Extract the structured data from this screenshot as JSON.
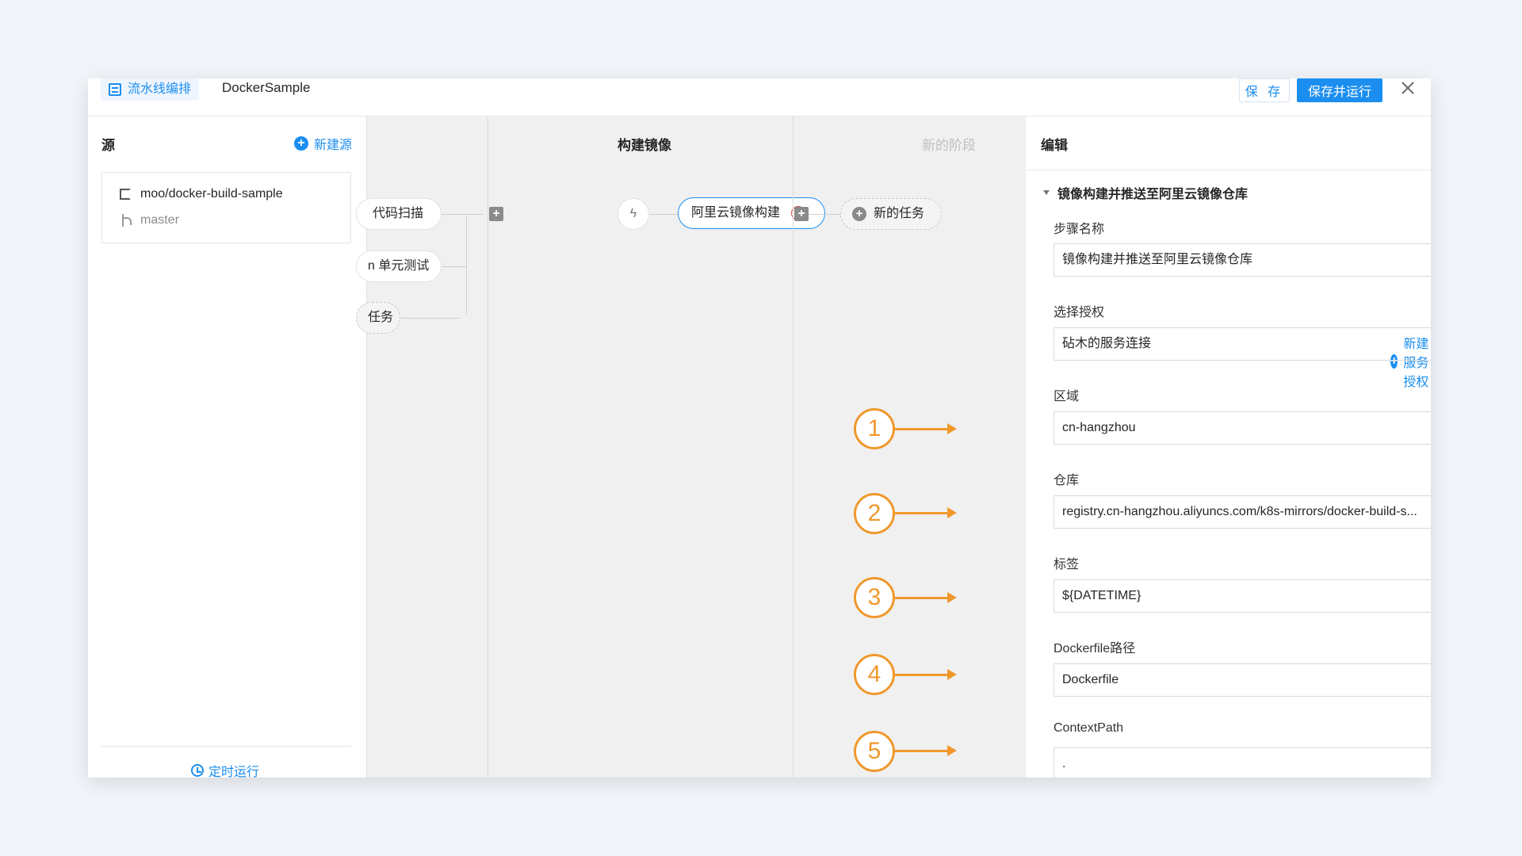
{
  "header": {
    "breadcrumb": "流水线编排",
    "pipeline_name": "DockerSample",
    "save_label": "保 存",
    "save_run_label": "保存并运行"
  },
  "source": {
    "title": "源",
    "new_source_label": "新建源",
    "repo": "moo/docker-build-sample",
    "branch": "master",
    "timer_label": "定时运行"
  },
  "canvas": {
    "prev_tasks": [
      "代码扫描",
      "n 单元测试",
      "任务"
    ],
    "stage_title": "构建镜像",
    "task_label": "阿里云镜像构建",
    "new_stage_label": "新的阶段",
    "new_task_label": "新的任务"
  },
  "editor": {
    "title": "编辑",
    "section_title": "镜像构建并推送至阿里云镜像仓库",
    "step_name_label": "步骤名称",
    "step_name_value": "镜像构建并推送至阿里云镜像仓库",
    "auth_label": "选择授权",
    "new_auth_label": "新建服务授权",
    "auth_value": "砧木的服务连接",
    "region_label": "区域",
    "region_value": "cn-hangzhou",
    "repo_label": "仓库",
    "repo_value": "registry.cn-hangzhou.aliyuncs.com/k8s-mirrors/docker-build-s...",
    "tag_label": "标签",
    "tag_value": "${DATETIME}",
    "dockerfile_label": "Dockerfile路径",
    "dockerfile_value": "Dockerfile",
    "context_label": "ContextPath",
    "context_value": "."
  },
  "annotations": [
    "1",
    "2",
    "3",
    "4",
    "5"
  ],
  "colors": {
    "accent": "#1b8ef0",
    "annotation": "#f0982c",
    "error": "#e04242"
  }
}
